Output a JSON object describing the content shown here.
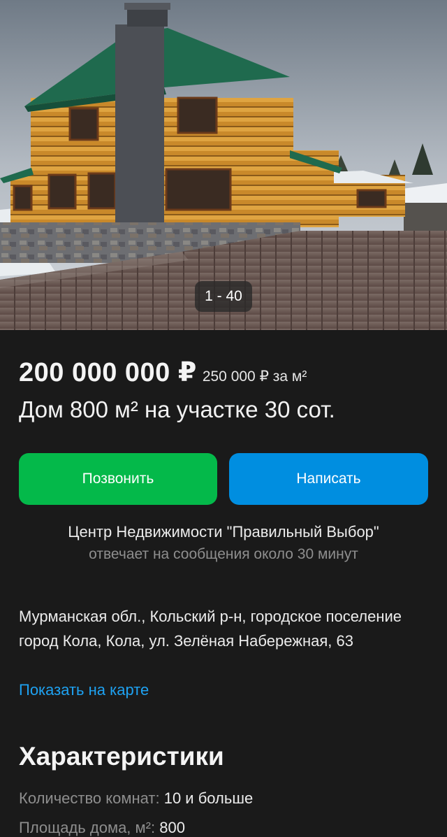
{
  "gallery": {
    "counter": "1 - 40",
    "image_alt": "Бревенчатый дом с зелёной крышей"
  },
  "listing": {
    "price": "200 000 000 ₽",
    "price_per_m2": "250 000 ₽ за м²",
    "title": "Дом 800 м² на участке 30 сот."
  },
  "actions": {
    "call_label": "Позвонить",
    "message_label": "Написать",
    "call_color": "#04b94a",
    "message_color": "#008ee0"
  },
  "seller": {
    "name": "Центр Недвижимости \"Правильный Выбор\"",
    "reply_time": "отвечает на сообщения около 30 минут"
  },
  "location": {
    "address": "Мурманская обл., Кольский р-н, городское поселение город Кола, Кола, ул. Зелёная Набережная, 63",
    "map_link": "Показать на карте"
  },
  "characteristics": {
    "title": "Характеристики",
    "items": [
      {
        "label": "Количество комнат:",
        "value": "10 и больше"
      },
      {
        "label": "Площадь дома, м²:",
        "value": "800"
      }
    ]
  },
  "colors": {
    "background": "#1a1a1a",
    "link": "#1ea2f2"
  }
}
